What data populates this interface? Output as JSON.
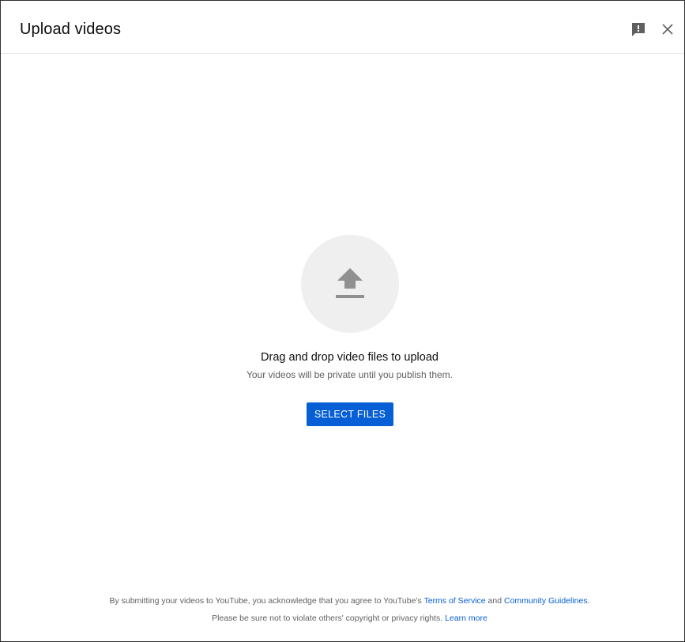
{
  "dialog": {
    "title": "Upload videos",
    "feedback_icon": "feedback-icon",
    "close_icon": "close-icon"
  },
  "dropzone": {
    "icon": "upload-arrow-icon",
    "heading": "Drag and drop video files to upload",
    "subtext": "Your videos will be private until you publish them.",
    "select_button_label": "SELECT FILES"
  },
  "footer": {
    "line1_prefix": "By submitting your videos to YouTube, you acknowledge that you agree to YouTube's ",
    "terms_link": "Terms of Service",
    "line1_and": " and ",
    "guidelines_link": "Community Guidelines",
    "line1_suffix": ".",
    "line2_prefix": "Please be sure not to violate others' copyright or privacy rights. ",
    "learn_more_link": "Learn more"
  },
  "colors": {
    "accent": "#065fd4",
    "icon_gray": "#909090",
    "circle_bg": "#efefef"
  }
}
